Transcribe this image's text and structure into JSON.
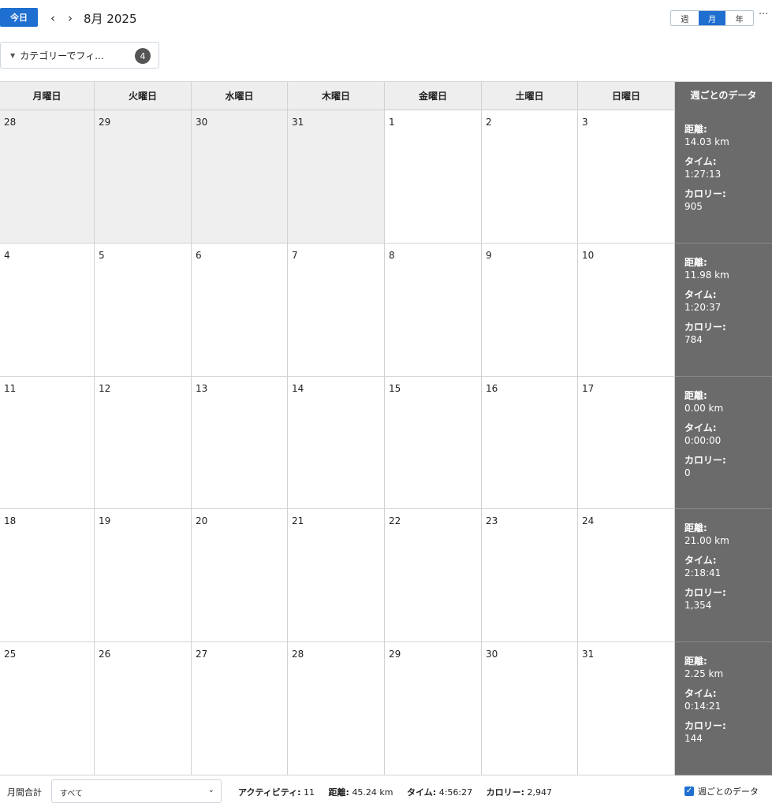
{
  "toolbar": {
    "today_label": "今日",
    "prev_icon": "‹",
    "next_icon": "›",
    "month_title": "8月 2025",
    "views": [
      "週",
      "月",
      "年"
    ],
    "active_view": "月",
    "more_icon": "···"
  },
  "filter": {
    "caret": "▼",
    "label": "カテゴリーでフィ...",
    "count": "4"
  },
  "weekdays": [
    "月曜日",
    "火曜日",
    "水曜日",
    "木曜日",
    "金曜日",
    "土曜日",
    "日曜日"
  ],
  "summary_header": "週ごとのデータ",
  "summary_labels": {
    "distance": "距離:",
    "time": "タイム:",
    "calories": "カロリー:"
  },
  "weeks": [
    {
      "days": [
        "28",
        "29",
        "30",
        "31",
        "1",
        "2",
        "3"
      ],
      "other_month": [
        true,
        true,
        true,
        true,
        false,
        false,
        false
      ],
      "distance": "14.03 km",
      "time": "1:27:13",
      "calories": "905"
    },
    {
      "days": [
        "4",
        "5",
        "6",
        "7",
        "8",
        "9",
        "10"
      ],
      "other_month": [
        false,
        false,
        false,
        false,
        false,
        false,
        false
      ],
      "distance": "11.98 km",
      "time": "1:20:37",
      "calories": "784"
    },
    {
      "days": [
        "11",
        "12",
        "13",
        "14",
        "15",
        "16",
        "17"
      ],
      "other_month": [
        false,
        false,
        false,
        false,
        false,
        false,
        false
      ],
      "distance": "0.00 km",
      "time": "0:00:00",
      "calories": "0"
    },
    {
      "days": [
        "18",
        "19",
        "20",
        "21",
        "22",
        "23",
        "24"
      ],
      "other_month": [
        false,
        false,
        false,
        false,
        false,
        false,
        false
      ],
      "distance": "21.00 km",
      "time": "2:18:41",
      "calories": "1,354"
    },
    {
      "days": [
        "25",
        "26",
        "27",
        "28",
        "29",
        "30",
        "31"
      ],
      "other_month": [
        false,
        false,
        false,
        false,
        false,
        false,
        false
      ],
      "distance": "2.25 km",
      "time": "0:14:21",
      "calories": "144"
    }
  ],
  "footer": {
    "monthly_total_label": "月間合計",
    "select_value": "すべて",
    "select_caret": "⌄",
    "activities_label": "アクティビティ:",
    "activities_value": "11",
    "distance_label": "距離:",
    "distance_value": "45.24 km",
    "time_label": "タイム:",
    "time_value": "4:56:27",
    "calories_label": "カロリー:",
    "calories_value": "2,947",
    "weekly_data_label": "週ごとのデータ",
    "weekly_data_checked": true,
    "check_mark": "✓"
  },
  "colors": {
    "accent": "#1f6fd1",
    "summary_bg": "#6b6b6b",
    "other_month_bg": "#efefef"
  }
}
